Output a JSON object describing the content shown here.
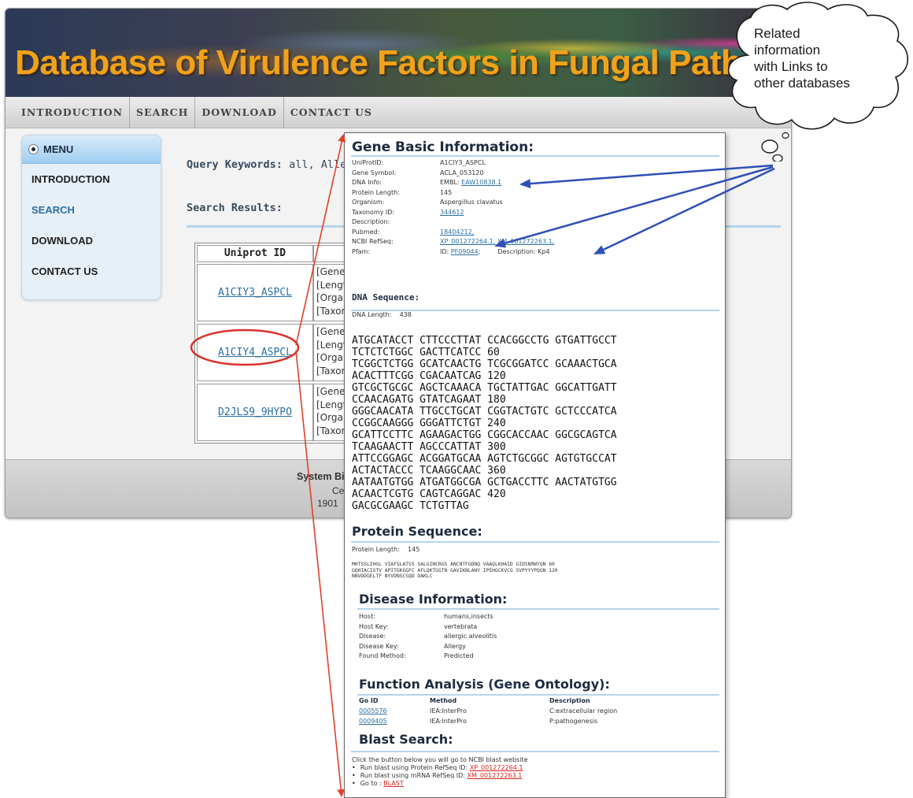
{
  "site": {
    "title": "Database of Virulence Factors in Fungal Pathogens",
    "nav": [
      "INTRODUCTION",
      "SEARCH",
      "DOWNLOAD",
      "CONTACT US"
    ],
    "menu": {
      "header": "MENU",
      "items": [
        "INTRODUCTION",
        "SEARCH",
        "DOWNLOAD",
        "CONTACT US"
      ]
    },
    "query_label": "Query Keywords:",
    "query_value": "all, Allerg",
    "search_results_label": "Search Results:",
    "table": {
      "col_header": "Uniprot ID",
      "rows": [
        {
          "id": "A1CIY3_ASPCL",
          "info": [
            "[Gene",
            "[Lengt",
            "[Organ",
            "[Taxon"
          ]
        },
        {
          "id": "A1CIY4_ASPCL",
          "info": [
            "[Gene",
            "[Lengt",
            "[Organ",
            "[Taxon"
          ]
        },
        {
          "id": "D2JLS9_9HYPO",
          "info": [
            "[Gene",
            "[Lengt",
            "[Organ",
            "[Taxon"
          ]
        }
      ]
    },
    "footer": [
      "System Bi",
      "Ce",
      "1901"
    ]
  },
  "detail": {
    "gene_basic": {
      "title": "Gene Basic Information:",
      "rows": [
        {
          "key": "UniProtID:",
          "value": "A1CIY3_ASPCL"
        },
        {
          "key": "Gene Symbol:",
          "value": "ACLA_053120"
        },
        {
          "key": "DNA Info:",
          "prefix": "EMBL: ",
          "link": "EAW10838.1"
        },
        {
          "key": "Protein Length:",
          "value": "145"
        },
        {
          "key": "Organism:",
          "value": "Aspergillus clavatus"
        },
        {
          "key": "Taxonomy ID:",
          "link": "344612"
        },
        {
          "key": "Description:",
          "value": ""
        },
        {
          "key": "Pubmed:",
          "link": "18404212,"
        },
        {
          "key": "NCBI RefSeq:",
          "link": "XP_001272264.1,",
          "link2": "XM_001272263.1,"
        },
        {
          "key": "Pfam:",
          "prefix": "ID: ",
          "link": "PF09044",
          "suffix": ";",
          "extra": "Description: Kp4"
        }
      ]
    },
    "dna": {
      "title": "DNA Sequence:",
      "length_label": "DNA Length:",
      "length": "438",
      "lines": [
        "ATGCATACCT CTTCCCTTAT CCACGGCCTG GTGATTGCCT",
        "TCTCTCTGGC GACTTCATCC 60",
        "TCGGCTCTGG GCATCAACTG TCGCGGATCC GCAAACTGCA",
        "ACACTTTCGG CGACAATCAG 120",
        "GTCGCTGCGC AGCTCAAACA TGCTATTGAC GGCATTGATT",
        "CCAACAGATG GTATCAGAAT 180",
        "GGGCAACATA TTGCCTGCAT CGGTACTGTC GCTCCCATCA",
        "CCGGCAAGGG GGGATTCTGT 240",
        "GCATTCCTTC AGAAGACTGG CGGCACCAAC GGCGCAGTCA",
        "TCAAGAACTT AGCCCATTAT 300",
        "ATTCCGGAGC ACGGATGCAA AGTCTGCGGC AGTGTGCCAT",
        "ACTACTACCC TCAAGGCAAC 360",
        "AATAATGTGG ATGATGGCGA GCTGACCTTC AACTATGTGG",
        "ACAACTCGTG CAGTCAGGAC 420",
        "GACGCGAAGC TCTGTTAG"
      ]
    },
    "protein": {
      "title": "Protein Sequence:",
      "length_label": "Protein Length:",
      "length": "145",
      "lines": [
        "MHTSSLIHGL VIAFSLATSS SALGINCRGS ANCNTFGDNQ VAAQLKHAID GIDSNRWYQN 60",
        "GQHIACIGTV APITGKGGFC AFLQKTGGTN GAVIKNLANY IPEHGCKVCG SVPYYYPQGN 120",
        "NNVDDGELTF NYVDNSCSQD DAKLC"
      ]
    },
    "disease": {
      "title": "Disease Information:",
      "rows": [
        {
          "key": "Host:",
          "value": "humans,insects"
        },
        {
          "key": "Host Key:",
          "value": "vertebrata"
        },
        {
          "key": "Disease:",
          "value": "allergic alveolitis"
        },
        {
          "key": "Disease Key:",
          "value": "Allergy"
        },
        {
          "key": "Found Method:",
          "value": "Predicted"
        }
      ]
    },
    "go": {
      "title": "Function Analysis (Gene Ontology):",
      "headers": [
        "Go ID",
        "Method",
        "Description"
      ],
      "rows": [
        {
          "id": "0005576",
          "method": "IEA:InterPro",
          "desc": "C:extracellular region"
        },
        {
          "id": "0009405",
          "method": "IEA:InterPro",
          "desc": "P:pathogenesis"
        }
      ]
    },
    "blast": {
      "title": "Blast Search:",
      "intro": "Click the button below you will go to NCBI blast website",
      "items": [
        {
          "text": "Run blast using Protein RefSeq ID: ",
          "link": "XP_001272264.1"
        },
        {
          "text": "Run blast using mRNA RefSeq ID: ",
          "link": "XM_001272263.1"
        },
        {
          "text": "Go to : ",
          "link": "BLAST"
        }
      ]
    }
  },
  "callout": {
    "lines": [
      "Related",
      "information",
      "with Links to",
      "other databases"
    ]
  },
  "colors": {
    "title_orange": "#f0a21b",
    "link_blue": "#2c6fa3",
    "annotation_red": "#e0402a",
    "annotation_blue": "#2f4fb5",
    "circle_red": "#d9322a"
  }
}
